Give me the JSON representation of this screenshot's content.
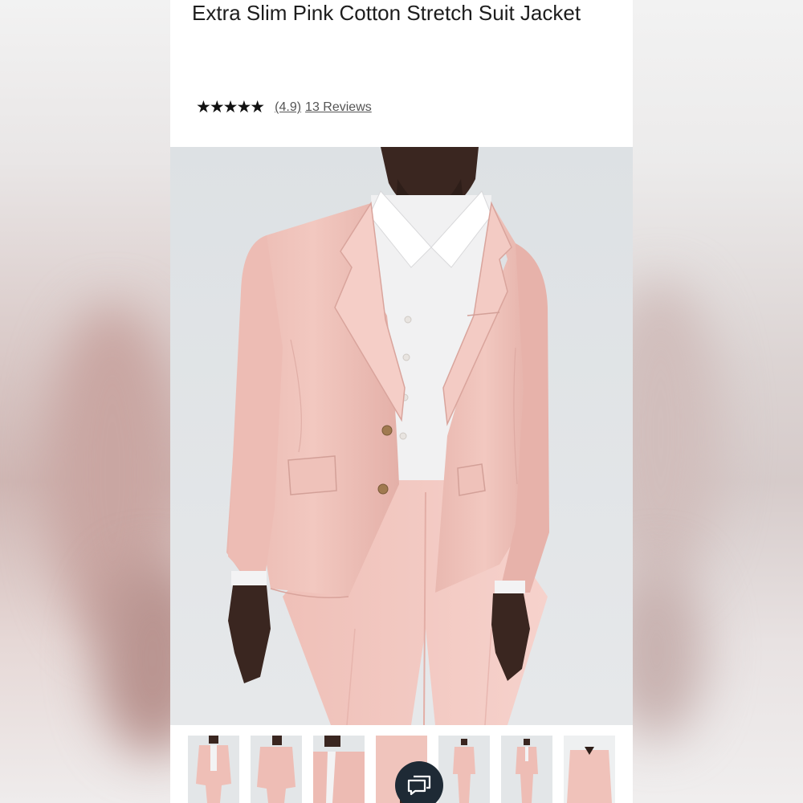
{
  "product": {
    "title": "Extra Slim Pink Cotton Stretch Suit Jacket",
    "rating_stars": "★★★★★",
    "rating_value": "(4.9)",
    "review_count": "13 Reviews"
  },
  "colors": {
    "suit_pink": "#eebfb7",
    "shirt_white": "#f1f1f2",
    "background_grey": "#e2e5e7",
    "chat_button": "#1e2a35"
  },
  "gallery": {
    "thumbnail_count": 7,
    "icons": [
      "chat-icon"
    ]
  }
}
